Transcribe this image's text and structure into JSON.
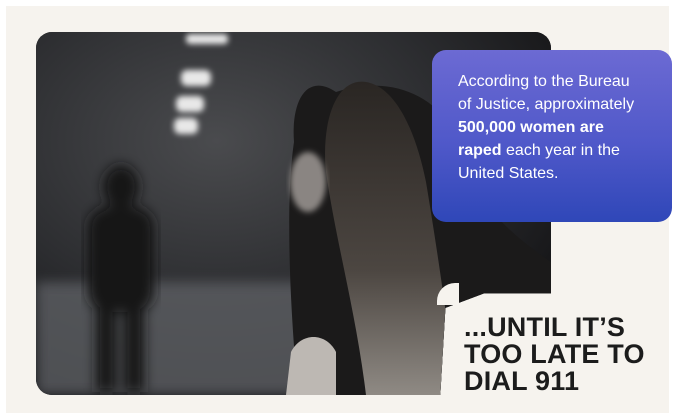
{
  "stat": {
    "line1": "According to the Bureau",
    "line2": "of Justice, approximately",
    "line3_bold": "500,000 women are",
    "line4_bold": "raped",
    "line4_rest": " each year in the",
    "line5": "United States."
  },
  "headline": {
    "line1": "...UNTIL IT’S",
    "line2": "TOO LATE TO",
    "line3": "DIAL 911"
  },
  "colors": {
    "background": "#f6f3ee",
    "stat_box_top": "#6c6ad3",
    "stat_box_bottom": "#2f47b8",
    "headline": "#1c1c1c"
  }
}
